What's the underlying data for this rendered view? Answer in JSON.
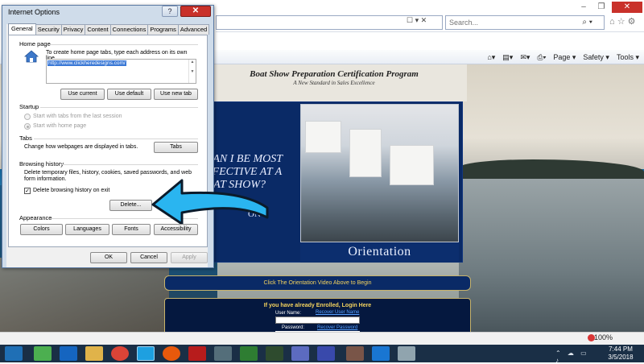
{
  "browser": {
    "search_placeholder": "Search...",
    "command_bar": {
      "page": "Page ▾",
      "safety": "Safety ▾",
      "tools": "Tools ▾"
    },
    "zoom": "100%"
  },
  "site": {
    "title": "Boat Show Preparation Certification Program",
    "subtitle": "A New Standard in Sales Excellence",
    "banner_text": "CAN I BE MOST\nFFECTIVE AT A\nOAT SHOW?",
    "banner_on": "ON",
    "orientation_label": "Orientation",
    "video_prompt": "Click The Orientation Video Above to Begin",
    "login_title": "If you have already Enrolled, Login Here",
    "user_label": "User Name:",
    "user_link": "Recover User Name",
    "password_label": "Password:",
    "password_link": "Recover Password"
  },
  "dialog": {
    "title": "Internet Options",
    "help": "?",
    "close": "✕",
    "tabs": [
      "General",
      "Security",
      "Privacy",
      "Content",
      "Connections",
      "Programs",
      "Advanced"
    ],
    "home_page": {
      "heading": "Home page",
      "instruction": "To create home page tabs, type each address on its own line.",
      "url": "http://www.clickheredesigns.com/",
      "buttons": [
        "Use current",
        "Use default",
        "Use new tab"
      ]
    },
    "startup": {
      "heading": "Startup",
      "options": [
        "Start with tabs from the last session",
        "Start with home page"
      ],
      "selected": 1
    },
    "tabs_section": {
      "heading": "Tabs",
      "text": "Change how webpages are displayed in tabs.",
      "button": "Tabs"
    },
    "browsing_history": {
      "heading": "Browsing history",
      "text": "Delete temporary files, history, cookies, saved passwords, and web form information.",
      "checkbox_label": "Delete browsing history on exit",
      "checked": true,
      "button": "Delete..."
    },
    "appearance": {
      "heading": "Appearance",
      "buttons": [
        "Colors",
        "Languages",
        "Fonts",
        "Accessibility"
      ]
    },
    "footer": {
      "ok": "OK",
      "cancel": "Cancel",
      "apply": "Apply"
    }
  },
  "taskbar": {
    "time": "7:44 PM",
    "date": "3/5/2018"
  },
  "colors": {
    "arrow": "#2ab5f0",
    "dialog_frame": "#cfdcea",
    "close": "#c9312a"
  }
}
